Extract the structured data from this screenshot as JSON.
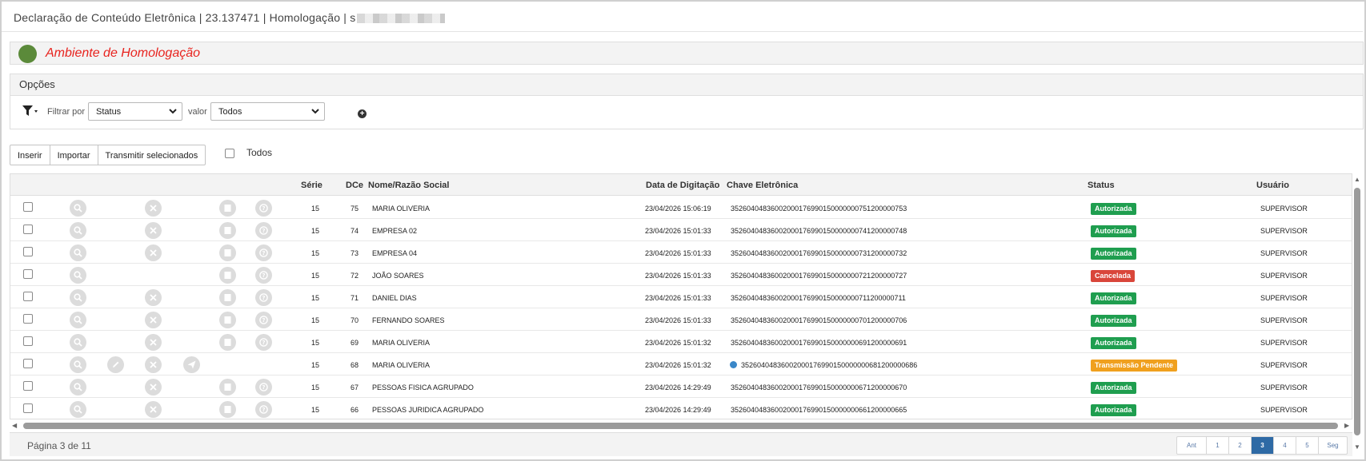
{
  "window": {
    "title": "Declaração de Conteúdo Eletrônica | 23.137471 | Homologação | s"
  },
  "environment": {
    "label": "Ambiente de Homologação",
    "dot_color": "#5b8a3a",
    "text_color": "#e8231e"
  },
  "options": {
    "title": "Opções",
    "filter_label": "Filtrar por",
    "filter_field": "Status",
    "value_label": "valor",
    "value_selected": "Todos"
  },
  "toolbar": {
    "insert_label": "Inserir",
    "import_label": "Importar",
    "transmit_label": "Transmitir selecionados",
    "select_all_label": "Todos"
  },
  "table": {
    "columns": {
      "serie": "Série",
      "dce": "DCe",
      "nome": "Nome/Razão Social",
      "data": "Data de Digitação",
      "chave": "Chave Eletrônica",
      "status": "Status",
      "usuario": "Usuário"
    },
    "rows": [
      {
        "serie": "15",
        "dce": "75",
        "nome": "MARIA OLIVERIA",
        "data": "23/04/2026 15:06:19",
        "chave": "35260404836002000176990150000000751200000753",
        "status": "Autorizada",
        "usuario": "SUPERVISOR",
        "status_color": "#1f9e4f",
        "actions": [
          "search",
          "cancel",
          "print",
          "help"
        ]
      },
      {
        "serie": "15",
        "dce": "74",
        "nome": "EMPRESA 02",
        "data": "23/04/2026 15:01:33",
        "chave": "35260404836002000176990150000000741200000748",
        "status": "Autorizada",
        "usuario": "SUPERVISOR",
        "status_color": "#1f9e4f",
        "actions": [
          "search",
          "cancel",
          "print",
          "help"
        ]
      },
      {
        "serie": "15",
        "dce": "73",
        "nome": "EMPRESA 04",
        "data": "23/04/2026 15:01:33",
        "chave": "35260404836002000176990150000000731200000732",
        "status": "Autorizada",
        "usuario": "SUPERVISOR",
        "status_color": "#1f9e4f",
        "actions": [
          "search",
          "cancel",
          "print",
          "help"
        ]
      },
      {
        "serie": "15",
        "dce": "72",
        "nome": "JOÃO SOARES",
        "data": "23/04/2026 15:01:33",
        "chave": "35260404836002000176990150000000721200000727",
        "status": "Cancelada",
        "usuario": "SUPERVISOR",
        "status_color": "#d9463a",
        "actions": [
          "search",
          "print",
          "help"
        ]
      },
      {
        "serie": "15",
        "dce": "71",
        "nome": "DANIEL DIAS",
        "data": "23/04/2026 15:01:33",
        "chave": "35260404836002000176990150000000711200000711",
        "status": "Autorizada",
        "usuario": "SUPERVISOR",
        "status_color": "#1f9e4f",
        "actions": [
          "search",
          "cancel",
          "print",
          "help"
        ]
      },
      {
        "serie": "15",
        "dce": "70",
        "nome": "FERNANDO SOARES",
        "data": "23/04/2026 15:01:33",
        "chave": "35260404836002000176990150000000701200000706",
        "status": "Autorizada",
        "usuario": "SUPERVISOR",
        "status_color": "#1f9e4f",
        "actions": [
          "search",
          "cancel",
          "print",
          "help"
        ]
      },
      {
        "serie": "15",
        "dce": "69",
        "nome": "MARIA OLIVERIA",
        "data": "23/04/2026 15:01:32",
        "chave": "35260404836002000176990150000000691200000691",
        "status": "Autorizada",
        "usuario": "SUPERVISOR",
        "status_color": "#1f9e4f",
        "actions": [
          "search",
          "cancel",
          "print",
          "help"
        ]
      },
      {
        "serie": "15",
        "dce": "68",
        "nome": "MARIA OLIVERIA",
        "data": "23/04/2026 15:01:32",
        "chave": "35260404836002000176990150000000681200000686",
        "status": "Transmissão Pendente",
        "usuario": "SUPERVISOR",
        "status_color": "#f0a01e",
        "pending_dot": true,
        "actions": [
          "search",
          "edit",
          "cancel",
          "send"
        ]
      },
      {
        "serie": "15",
        "dce": "67",
        "nome": "PESSOAS FISICA AGRUPADO",
        "data": "23/04/2026 14:29:49",
        "chave": "35260404836002000176990150000000671200000670",
        "status": "Autorizada",
        "usuario": "SUPERVISOR",
        "status_color": "#1f9e4f",
        "actions": [
          "search",
          "cancel",
          "print",
          "help"
        ]
      },
      {
        "serie": "15",
        "dce": "66",
        "nome": "PESSOAS JURIDICA AGRUPADO",
        "data": "23/04/2026 14:29:49",
        "chave": "35260404836002000176990150000000661200000665",
        "status": "Autorizada",
        "usuario": "SUPERVISOR",
        "status_color": "#1f9e4f",
        "actions": [
          "search",
          "cancel",
          "print",
          "help"
        ]
      }
    ]
  },
  "pagination": {
    "info": "Página 3 de 11",
    "prev": "Ant",
    "next": "Seg",
    "pages": [
      "1",
      "2",
      "3",
      "4",
      "5"
    ],
    "current": "3",
    "active_color": "#2e6aa5"
  }
}
